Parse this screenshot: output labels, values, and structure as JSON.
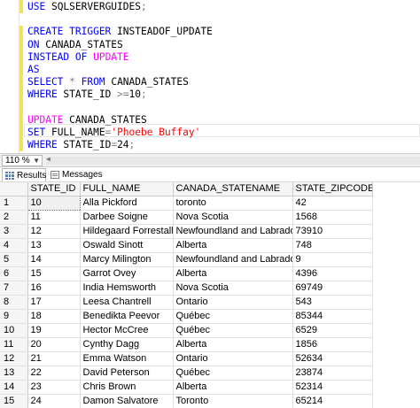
{
  "editor": {
    "lines": [
      {
        "tokens": [
          {
            "t": "USE ",
            "c": "kw"
          },
          {
            "t": "SQLSERVERGUIDES",
            "c": ""
          },
          {
            "t": ";",
            "c": "op"
          }
        ]
      },
      {
        "tokens": []
      },
      {
        "tokens": [
          {
            "t": "CREATE TRIGGER ",
            "c": "kw"
          },
          {
            "t": "INSTEADOF_UPDATE",
            "c": ""
          }
        ]
      },
      {
        "tokens": [
          {
            "t": "ON ",
            "c": "kw"
          },
          {
            "t": "CANADA_STATES",
            "c": ""
          }
        ]
      },
      {
        "tokens": [
          {
            "t": "INSTEAD OF ",
            "c": "kw"
          },
          {
            "t": "UPDATE",
            "c": "fn"
          }
        ]
      },
      {
        "tokens": [
          {
            "t": "AS",
            "c": "kw"
          }
        ]
      },
      {
        "tokens": [
          {
            "t": "SELECT ",
            "c": "kw"
          },
          {
            "t": "* ",
            "c": "op"
          },
          {
            "t": "FROM ",
            "c": "kw"
          },
          {
            "t": "CANADA_STATES",
            "c": ""
          }
        ]
      },
      {
        "tokens": [
          {
            "t": "WHERE ",
            "c": "kw"
          },
          {
            "t": "STATE_ID ",
            "c": ""
          },
          {
            "t": ">=",
            "c": "op"
          },
          {
            "t": "10",
            "c": ""
          },
          {
            "t": ";",
            "c": "op"
          }
        ]
      },
      {
        "tokens": []
      },
      {
        "tokens": [
          {
            "t": "UPDATE ",
            "c": "fn"
          },
          {
            "t": "CANADA_STATES",
            "c": ""
          }
        ]
      },
      {
        "tokens": [
          {
            "t": "SET ",
            "c": "kw"
          },
          {
            "t": "FULL_NAME",
            "c": ""
          },
          {
            "t": "=",
            "c": "op"
          },
          {
            "t": "'Phoebe Buffay'",
            "c": "str"
          }
        ]
      },
      {
        "tokens": [
          {
            "t": "WHERE ",
            "c": "kw"
          },
          {
            "t": "STATE_ID",
            "c": ""
          },
          {
            "t": "=",
            "c": "op"
          },
          {
            "t": "24",
            "c": ""
          },
          {
            "t": ";",
            "c": "op"
          }
        ]
      }
    ]
  },
  "zoom": {
    "value": "110 %"
  },
  "tabs": {
    "results": "Results",
    "messages": "Messages"
  },
  "grid": {
    "columns": [
      "STATE_ID",
      "FULL_NAME",
      "CANADA_STATENAME",
      "STATE_ZIPCODE"
    ],
    "rows": [
      [
        "1",
        "10",
        "Alla Pickford",
        "toronto",
        "42"
      ],
      [
        "2",
        "11",
        "Darbee Soigne",
        "Nova Scotia",
        "1568"
      ],
      [
        "3",
        "12",
        "Hildegaard Forrestall",
        "Newfoundland and Labrador",
        "73910"
      ],
      [
        "4",
        "13",
        "Oswald Sinott",
        "Alberta",
        "748"
      ],
      [
        "5",
        "14",
        "Marcy Milington",
        "Newfoundland and Labrador",
        "9"
      ],
      [
        "6",
        "15",
        "Garrot Ovey",
        "Alberta",
        "4396"
      ],
      [
        "7",
        "16",
        "India Hemsworth",
        "Nova Scotia",
        "69749"
      ],
      [
        "8",
        "17",
        "Leesa Chantrell",
        "Ontario",
        "543"
      ],
      [
        "9",
        "18",
        "Benedikta Peevor",
        "Québec",
        "85344"
      ],
      [
        "10",
        "19",
        "Hector McCree",
        "Québec",
        "6529"
      ],
      [
        "11",
        "20",
        "Cynthy Dagg",
        "Alberta",
        "1856"
      ],
      [
        "12",
        "21",
        "Emma Watson",
        "Ontario",
        "52634"
      ],
      [
        "13",
        "22",
        "David Peterson",
        "Québec",
        "23874"
      ],
      [
        "14",
        "23",
        "Chris Brown",
        "Alberta",
        "52314"
      ],
      [
        "15",
        "24",
        "Damon Salvatore",
        "Toronto",
        "65214"
      ]
    ]
  },
  "colors": {
    "keyword": "#0000ff",
    "function": "#ff00ff",
    "string": "#ff0000",
    "operator": "#808080",
    "change_bar": "#f4e25b"
  }
}
